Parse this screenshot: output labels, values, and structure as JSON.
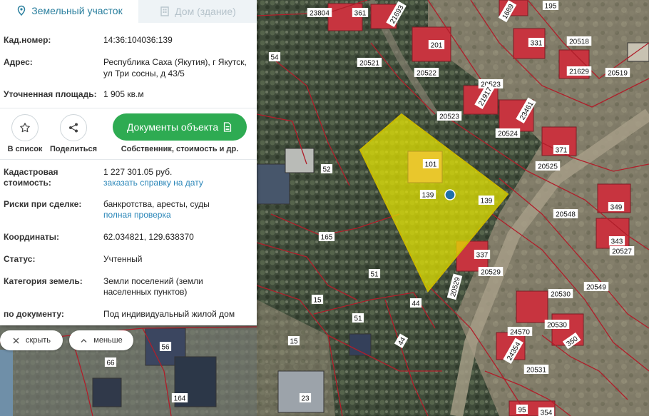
{
  "tabs": {
    "land": "Земельный участок",
    "house": "Дом (здание)"
  },
  "info": {
    "cadastral_label": "Кад.номер:",
    "cadastral_value": "14:36:104036:139",
    "address_label": "Адрес:",
    "address_line1": "Республика Саха (Якутия), г Якутск,",
    "address_line2": "ул Три сосны, д 43/5",
    "area_label": "Уточненная площадь:",
    "area_value": "1 905 кв.м",
    "cost_label_1": "Кадастровая",
    "cost_label_2": "стоимость:",
    "cost_value": "1 227 301.05 руб.",
    "cost_link": "заказать справку на дату",
    "risks_label": "Риски при сделке:",
    "risks_value": "банкротства, аресты, суды",
    "risks_link": "полная проверка",
    "coords_label": "Координаты:",
    "coords_value": "62.034821, 129.638370",
    "status_label": "Статус:",
    "status_value": "Учтенный",
    "category_label": "Категория земель:",
    "category_line1": "Земли поселений (земли",
    "category_line2": "населенных пунктов)",
    "document_label": "по документу:",
    "document_value": "Под индивидуальный жилой дом"
  },
  "actions": {
    "to_list": "В список",
    "share": "Поделиться",
    "documents_button": "Документы объекта",
    "documents_caption": "Собственник, стоимость и др."
  },
  "controls": {
    "hide": "скрыть",
    "less": "меньше"
  },
  "map": {
    "parcel_color": "#e6e600",
    "boundary_color": "#b01e2a",
    "labels": [
      "23804",
      "361",
      "21693",
      "1689",
      "195",
      "54",
      "20521",
      "201",
      "331",
      "20518",
      "20522",
      "21629",
      "20519",
      "20523",
      "21917",
      "20523",
      "23461",
      "20524",
      "371",
      "101",
      "52",
      "20525",
      "139",
      "139",
      "20548",
      "349",
      "165",
      "343",
      "337",
      "20527",
      "51",
      "20529",
      "20549",
      "15",
      "44",
      "20529",
      "20530",
      "20530",
      "51",
      "24570",
      "350",
      "56",
      "15",
      "44",
      "24354",
      "66",
      "20531",
      "164",
      "23",
      "95",
      "354"
    ]
  },
  "icons": {
    "land_tab": "map-pin-icon",
    "house_tab": "building-icon",
    "favorite": "star-icon",
    "share": "share-icon",
    "document": "document-icon",
    "hide": "close-icon",
    "less": "chevron-up-icon",
    "parcel_marker": "location-dot-icon"
  }
}
